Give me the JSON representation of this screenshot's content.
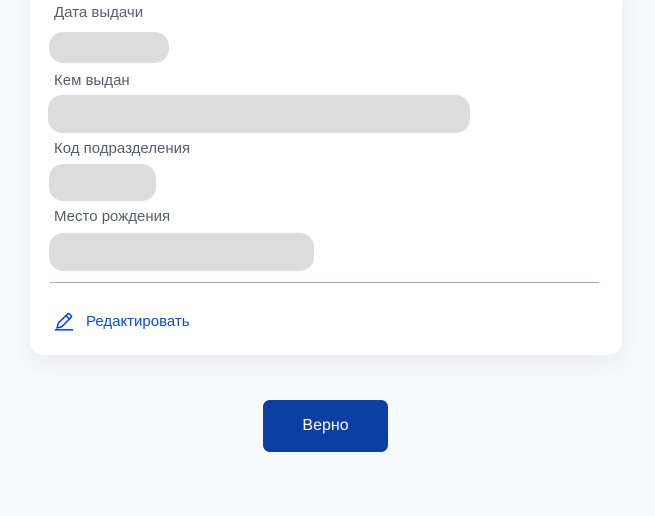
{
  "fields": {
    "issue_date": {
      "label": "Дата выдачи"
    },
    "issued_by": {
      "label": "Кем выдан"
    },
    "department_code": {
      "label": "Код подразделения"
    },
    "birthplace": {
      "label": "Место рождения"
    }
  },
  "edit": {
    "label": "Редактировать",
    "icon": "pencil-icon"
  },
  "confirm": {
    "label": "Верно"
  },
  "colors": {
    "page_background": "#f7f9fc",
    "card_background": "#ffffff",
    "placeholder": "#dcdcdc",
    "label_text": "#535f6e",
    "link": "#0d4cd3",
    "primary_button": "#0d3ea4",
    "divider": "#9aaec8"
  }
}
